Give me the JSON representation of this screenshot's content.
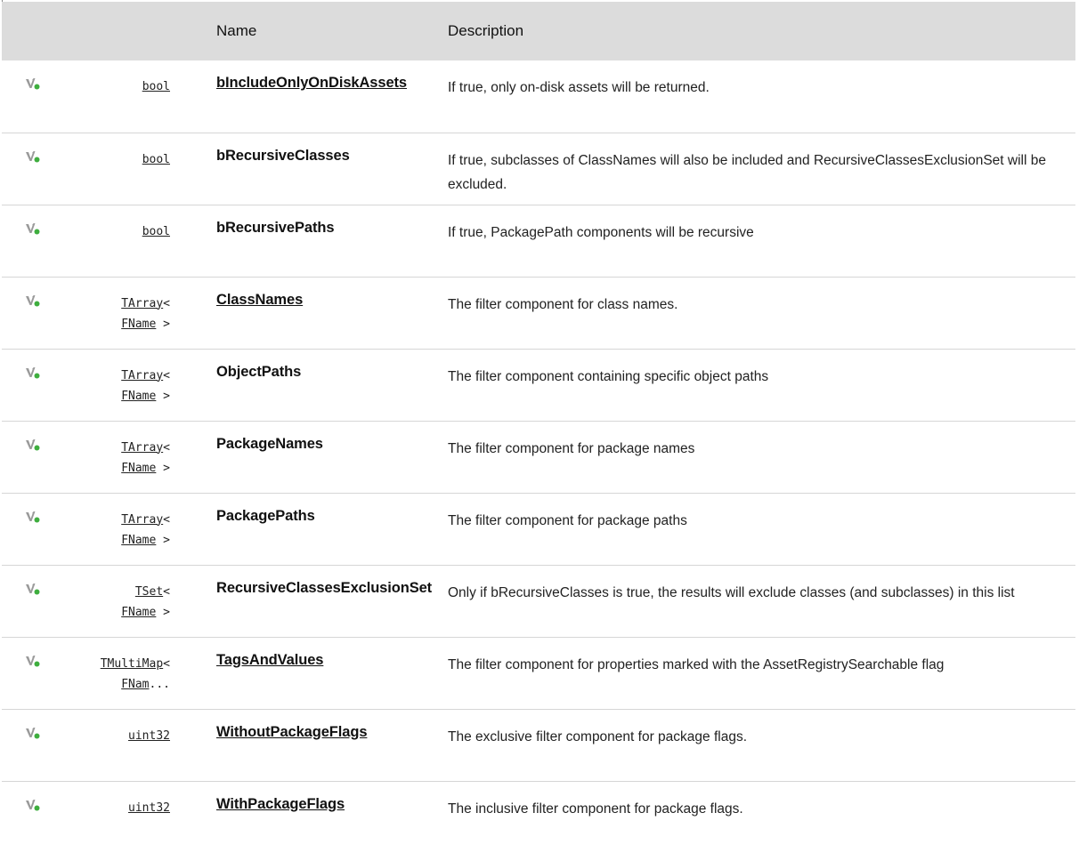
{
  "header": {
    "col_icon": "",
    "col_type": "",
    "col_name": "Name",
    "col_desc": "Description"
  },
  "rows": [
    {
      "icon": "public-variable-icon",
      "type_main": "bool",
      "type_rest": "",
      "type_line2_link": "",
      "type_line2_rest": "",
      "name": "bIncludeOnlyOnDiskAssets",
      "name_link": true,
      "desc": "If true, only on-disk assets will be returned."
    },
    {
      "icon": "public-variable-icon",
      "type_main": "bool",
      "type_rest": "",
      "type_line2_link": "",
      "type_line2_rest": "",
      "name": "bRecursiveClasses",
      "name_link": false,
      "desc": "If true, subclasses of ClassNames will also be included and RecursiveClassesExclusionSet will be excluded."
    },
    {
      "icon": "public-variable-icon",
      "type_main": "bool",
      "type_rest": "",
      "type_line2_link": "",
      "type_line2_rest": "",
      "name": "bRecursivePaths",
      "name_link": false,
      "desc": "If true, PackagePath components will be recursive"
    },
    {
      "icon": "public-variable-icon",
      "type_main": "TArray",
      "type_rest": "<",
      "type_line2_link": "FName",
      "type_line2_rest": " >",
      "name": "ClassNames",
      "name_link": true,
      "desc": "The filter component for class names."
    },
    {
      "icon": "public-variable-icon",
      "type_main": "TArray",
      "type_rest": "<",
      "type_line2_link": "FName",
      "type_line2_rest": " >",
      "name": "ObjectPaths",
      "name_link": false,
      "desc": "The filter component containing specific object paths"
    },
    {
      "icon": "public-variable-icon",
      "type_main": "TArray",
      "type_rest": "<",
      "type_line2_link": "FName",
      "type_line2_rest": " >",
      "name": "PackageNames",
      "name_link": false,
      "desc": "The filter component for package names"
    },
    {
      "icon": "public-variable-icon",
      "type_main": "TArray",
      "type_rest": "<",
      "type_line2_link": "FName",
      "type_line2_rest": " >",
      "name": "PackagePaths",
      "name_link": false,
      "desc": "The filter component for package paths"
    },
    {
      "icon": "public-variable-icon",
      "type_main": "TSet",
      "type_rest": "<",
      "type_line2_link": "FName",
      "type_line2_rest": " >",
      "name": "RecursiveClassesExclusionSet",
      "name_link": false,
      "desc": "Only if bRecursiveClasses is true, the results will exclude classes (and subclasses) in this list"
    },
    {
      "icon": "public-variable-icon",
      "type_main": "TMultiMap",
      "type_rest": "<",
      "type_line2_link": "FNam",
      "type_line2_rest": "...",
      "name": "TagsAndValues",
      "name_link": true,
      "desc": "The filter component for properties marked with the AssetRegistrySearchable flag"
    },
    {
      "icon": "public-variable-icon",
      "type_main": "uint32",
      "type_rest": "",
      "type_line2_link": "",
      "type_line2_rest": "",
      "name": "WithoutPackageFlags",
      "name_link": true,
      "desc": "The exclusive filter component for package flags."
    },
    {
      "icon": "public-variable-icon",
      "type_main": "uint32",
      "type_rest": "",
      "type_line2_link": "",
      "type_line2_rest": "",
      "name": "WithPackageFlags",
      "name_link": true,
      "desc": "The inclusive filter component for package flags."
    }
  ],
  "colors": {
    "header_bg": "#dcdcdc",
    "row_border": "#d6d6d6",
    "icon_gray": "#9a9a9a",
    "icon_green": "#3fae3f"
  }
}
